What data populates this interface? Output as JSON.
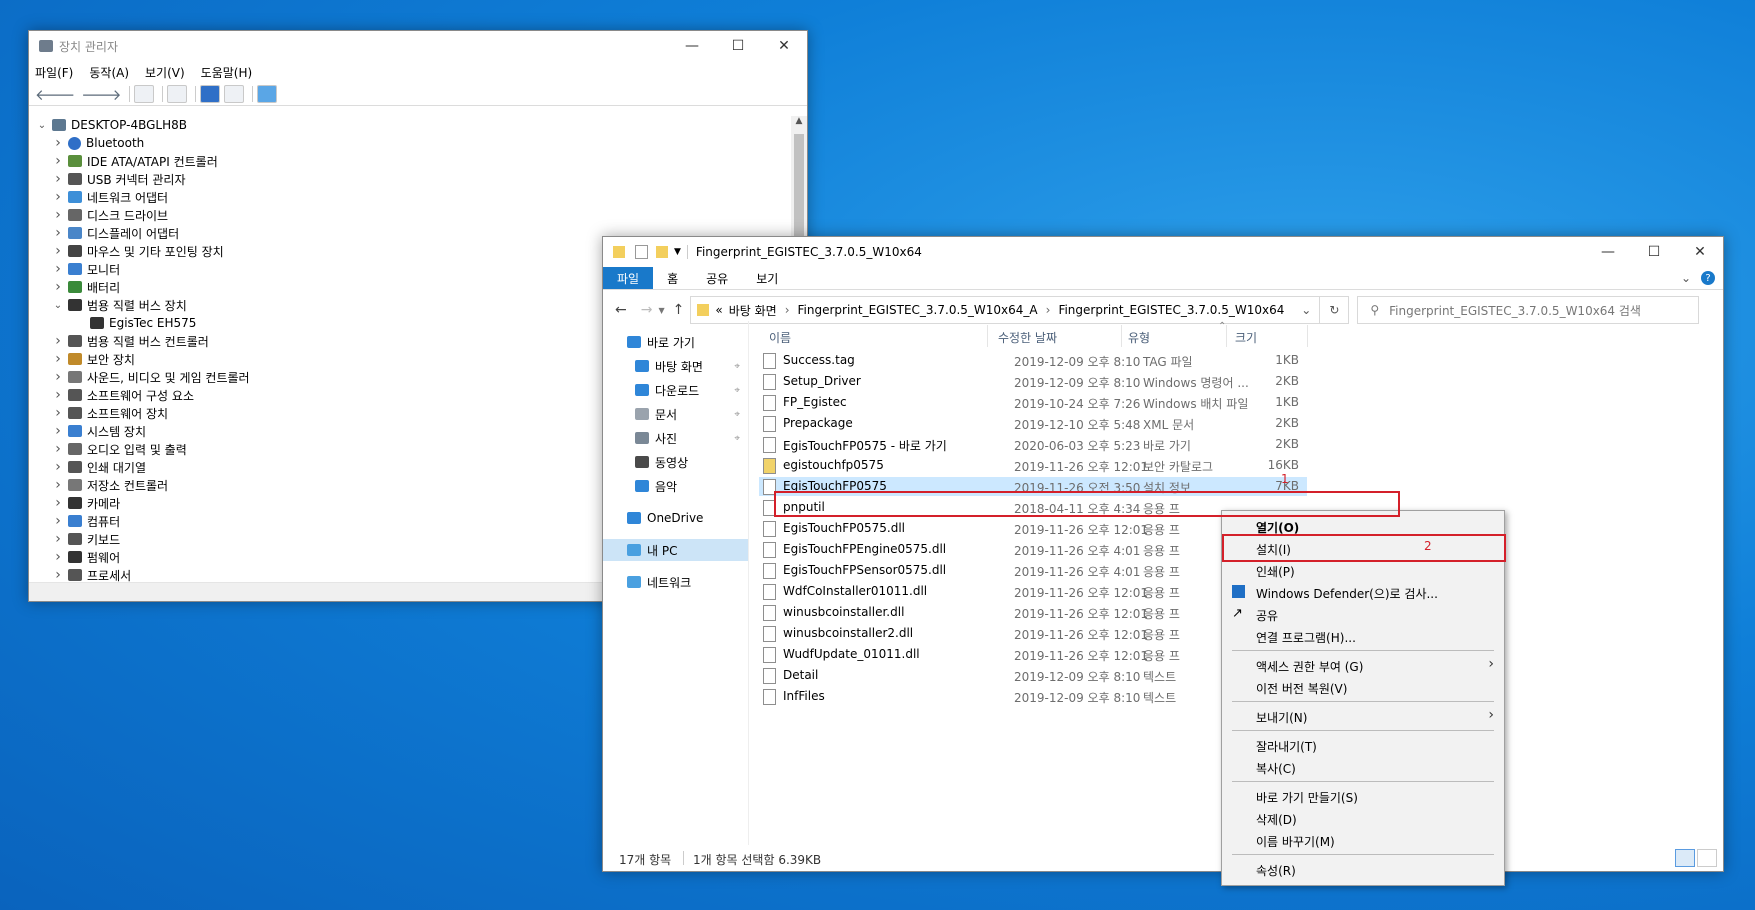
{
  "device_manager": {
    "title": "장치 관리자",
    "menu": [
      "파일(F)",
      "동작(A)",
      "보기(V)",
      "도움말(H)"
    ],
    "root": "DESKTOP-4BGLH8B",
    "nodes": [
      {
        "label": "Bluetooth",
        "icon": "bluetooth-icon",
        "expanded": false,
        "level": 1
      },
      {
        "label": "IDE ATA/ATAPI 컨트롤러",
        "icon": "ide-controller-icon",
        "expanded": false,
        "level": 1
      },
      {
        "label": "USB 커넥터 관리자",
        "icon": "usb-icon",
        "expanded": false,
        "level": 1
      },
      {
        "label": "네트워크 어댑터",
        "icon": "network-adapter-icon",
        "expanded": false,
        "level": 1
      },
      {
        "label": "디스크 드라이브",
        "icon": "disk-drive-icon",
        "expanded": false,
        "level": 1
      },
      {
        "label": "디스플레이 어댑터",
        "icon": "display-adapter-icon",
        "expanded": false,
        "level": 1
      },
      {
        "label": "마우스 및 기타 포인팅 장치",
        "icon": "mouse-icon",
        "expanded": false,
        "level": 1
      },
      {
        "label": "모니터",
        "icon": "monitor-icon",
        "expanded": false,
        "level": 1
      },
      {
        "label": "배터리",
        "icon": "battery-icon",
        "expanded": false,
        "level": 1
      },
      {
        "label": "범용 직렬 버스 장치",
        "icon": "usb-device-icon",
        "expanded": true,
        "level": 1
      },
      {
        "label": "EgisTec EH575",
        "icon": "usb-device-icon",
        "expanded": null,
        "level": 2
      },
      {
        "label": "범용 직렬 버스 컨트롤러",
        "icon": "usb-controller-icon",
        "expanded": false,
        "level": 1
      },
      {
        "label": "보안 장치",
        "icon": "security-device-icon",
        "expanded": false,
        "level": 1
      },
      {
        "label": "사운드, 비디오 및 게임 컨트롤러",
        "icon": "sound-icon",
        "expanded": false,
        "level": 1
      },
      {
        "label": "소프트웨어 구성 요소",
        "icon": "software-component-icon",
        "expanded": false,
        "level": 1
      },
      {
        "label": "소프트웨어 장치",
        "icon": "software-device-icon",
        "expanded": false,
        "level": 1
      },
      {
        "label": "시스템 장치",
        "icon": "system-device-icon",
        "expanded": false,
        "level": 1
      },
      {
        "label": "오디오 입력 및 출력",
        "icon": "audio-icon",
        "expanded": false,
        "level": 1
      },
      {
        "label": "인쇄 대기열",
        "icon": "printer-icon",
        "expanded": false,
        "level": 1
      },
      {
        "label": "저장소 컨트롤러",
        "icon": "storage-controller-icon",
        "expanded": false,
        "level": 1
      },
      {
        "label": "카메라",
        "icon": "camera-icon",
        "expanded": false,
        "level": 1
      },
      {
        "label": "컴퓨터",
        "icon": "computer-icon",
        "expanded": false,
        "level": 1
      },
      {
        "label": "키보드",
        "icon": "keyboard-icon",
        "expanded": false,
        "level": 1
      },
      {
        "label": "펌웨어",
        "icon": "firmware-icon",
        "expanded": false,
        "level": 1
      },
      {
        "label": "프로세서",
        "icon": "processor-icon",
        "expanded": false,
        "level": 1
      }
    ]
  },
  "explorer": {
    "title": "Fingerprint_EGISTEC_3.7.0.5_W10x64",
    "ribbon_tabs": [
      "파일",
      "홈",
      "공유",
      "보기"
    ],
    "breadcrumb": [
      "«",
      "바탕 화면",
      "Fingerprint_EGISTEC_3.7.0.5_W10x64_A",
      "Fingerprint_EGISTEC_3.7.0.5_W10x64"
    ],
    "search_placeholder": "Fingerprint_EGISTEC_3.7.0.5_W10x64 검색",
    "nav": [
      {
        "label": "바로 가기",
        "icon": "star-icon",
        "pinned": false,
        "indent": 0
      },
      {
        "label": "바탕 화면",
        "icon": "desktop-icon",
        "pinned": true,
        "indent": 1
      },
      {
        "label": "다운로드",
        "icon": "download-icon",
        "pinned": true,
        "indent": 1
      },
      {
        "label": "문서",
        "icon": "document-icon",
        "pinned": true,
        "indent": 1
      },
      {
        "label": "사진",
        "icon": "picture-icon",
        "pinned": true,
        "indent": 1
      },
      {
        "label": "동영상",
        "icon": "video-icon",
        "pinned": false,
        "indent": 1
      },
      {
        "label": "음악",
        "icon": "music-icon",
        "pinned": false,
        "indent": 1
      },
      {
        "label": "OneDrive",
        "icon": "cloud-icon",
        "pinned": false,
        "indent": 0
      },
      {
        "label": "내 PC",
        "icon": "pc-icon",
        "pinned": false,
        "indent": 0,
        "selected": true
      },
      {
        "label": "네트워크",
        "icon": "network-icon",
        "pinned": false,
        "indent": 0
      }
    ],
    "columns": [
      "이름",
      "수정한 날짜",
      "유형",
      "크기"
    ],
    "files": [
      {
        "name": "Success.tag",
        "date": "2019-12-09 오후 8:10",
        "type": "TAG 파일",
        "size": "1KB"
      },
      {
        "name": "Setup_Driver",
        "date": "2019-12-09 오후 8:10",
        "type": "Windows 명령어 ...",
        "size": "2KB"
      },
      {
        "name": "FP_Egistec",
        "date": "2019-10-24 오후 7:26",
        "type": "Windows 배치 파일",
        "size": "1KB"
      },
      {
        "name": "Prepackage",
        "date": "2019-12-10 오후 5:48",
        "type": "XML 문서",
        "size": "2KB"
      },
      {
        "name": "EgisTouchFP0575 - 바로 가기",
        "date": "2020-06-03 오후 5:23",
        "type": "바로 가기",
        "size": "2KB"
      },
      {
        "name": "egistouchfp0575",
        "date": "2019-11-26 오후 12:01",
        "type": "보안 카탈로그",
        "size": "16KB"
      },
      {
        "name": "EgisTouchFP0575",
        "date": "2019-11-26 오전 3:50",
        "type": "설치 정보",
        "size": "7KB",
        "selected": true
      },
      {
        "name": "pnputil",
        "date": "2018-04-11 오후 4:34",
        "type": "응용 프",
        "size": ""
      },
      {
        "name": "EgisTouchFP0575.dll",
        "date": "2019-11-26 오후 12:01",
        "type": "응용 프",
        "size": ""
      },
      {
        "name": "EgisTouchFPEngine0575.dll",
        "date": "2019-11-26 오후 4:01",
        "type": "응용 프",
        "size": ""
      },
      {
        "name": "EgisTouchFPSensor0575.dll",
        "date": "2019-11-26 오후 4:01",
        "type": "응용 프",
        "size": ""
      },
      {
        "name": "WdfCoInstaller01011.dll",
        "date": "2019-11-26 오후 12:01",
        "type": "응용 프",
        "size": ""
      },
      {
        "name": "winusbcoinstaller.dll",
        "date": "2019-11-26 오후 12:01",
        "type": "응용 프",
        "size": ""
      },
      {
        "name": "winusbcoinstaller2.dll",
        "date": "2019-11-26 오후 12:01",
        "type": "응용 프",
        "size": ""
      },
      {
        "name": "WudfUpdate_01011.dll",
        "date": "2019-11-26 오후 12:01",
        "type": "응용 프",
        "size": ""
      },
      {
        "name": "Detail",
        "date": "2019-12-09 오후 8:10",
        "type": "텍스트",
        "size": ""
      },
      {
        "name": "InfFiles",
        "date": "2019-12-09 오후 8:10",
        "type": "텍스트",
        "size": ""
      }
    ],
    "status_count": "17개 항목",
    "status_selection": "1개 항목 선택함 6.39KB"
  },
  "context_menu": {
    "groups": [
      [
        {
          "label": "열기(O)",
          "bold": true
        },
        {
          "label": "설치(I)",
          "highlight": true
        },
        {
          "label": "인쇄(P)"
        },
        {
          "label": "Windows Defender(으)로 검사...",
          "icon": "defender-icon"
        },
        {
          "label": "공유",
          "icon": "share-icon"
        },
        {
          "label": "연결 프로그램(H)..."
        }
      ],
      [
        {
          "label": "액세스 권한 부여 (G)",
          "submenu": true
        },
        {
          "label": "이전 버전 복원(V)"
        }
      ],
      [
        {
          "label": "보내기(N)",
          "submenu": true
        }
      ],
      [
        {
          "label": "잘라내기(T)"
        },
        {
          "label": "복사(C)"
        }
      ],
      [
        {
          "label": "바로 가기 만들기(S)"
        },
        {
          "label": "삭제(D)"
        },
        {
          "label": "이름 바꾸기(M)"
        }
      ],
      [
        {
          "label": "속성(R)"
        }
      ]
    ]
  },
  "annotations": {
    "file_marker": "1",
    "menu_marker": "2",
    "color": "#d4202a"
  }
}
